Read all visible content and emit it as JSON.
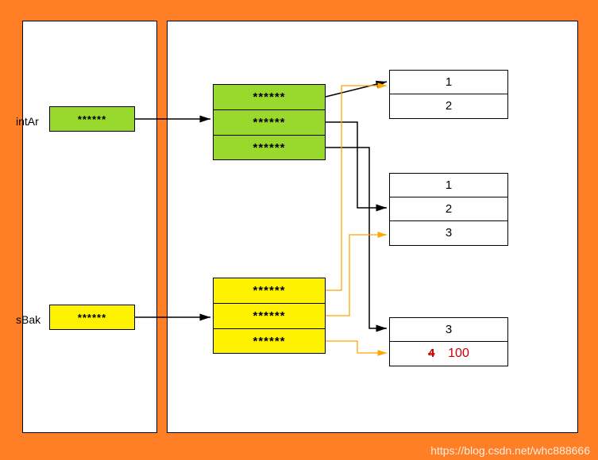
{
  "labels": {
    "intAr": "intAr",
    "sBak": "sBak"
  },
  "pointers": {
    "intArBox": "******",
    "sBakBox": "******",
    "greenArr": [
      "******",
      "******",
      "******"
    ],
    "yellowArr": [
      "******",
      "******",
      "******"
    ]
  },
  "arrays": {
    "top": [
      "1",
      "2"
    ],
    "middle": [
      "1",
      "2",
      "3"
    ],
    "bottom": {
      "row1": "3",
      "row2_struck": "4",
      "row2_new": "100"
    }
  },
  "watermark": "https://blog.csdn.net/whc888666"
}
